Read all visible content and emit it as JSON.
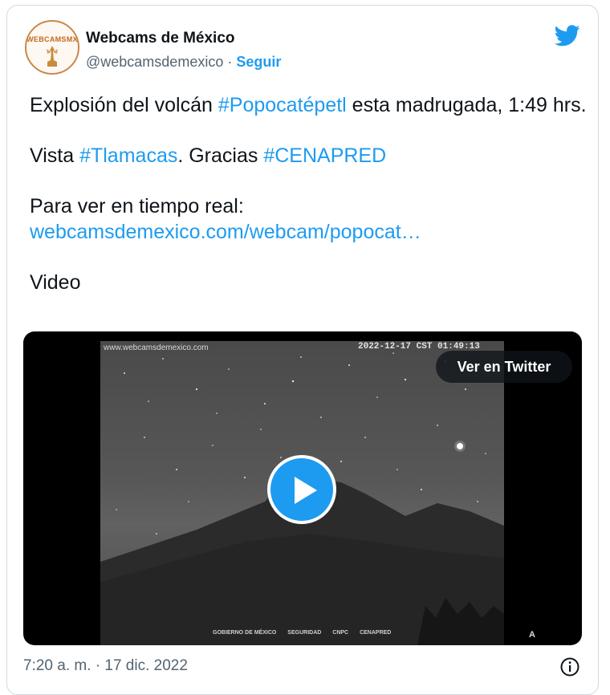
{
  "account": {
    "display_name": "Webcams de México",
    "handle": "@webcamsdemexico",
    "separator": "·",
    "follow_label": "Seguir",
    "avatar_text": "WEBCAMSMX"
  },
  "tweet": {
    "line1_pre": "Explosión del volcán ",
    "hashtag1": "#Popocatépetl",
    "line1_post": " esta madrugada, 1:49 hrs.",
    "line2_pre": "Vista ",
    "hashtag2": "#Tlamacas",
    "line2_mid": ". Gracias ",
    "hashtag3": "#CENAPRED",
    "line3": "Para ver en tiempo real:",
    "link": "webcamsdemexico.com/webcam/popocat…",
    "line4": "Video"
  },
  "media": {
    "watermark": "www.webcamsdemexico.com",
    "timestamp_overlay": "2022-12-17 CST 01:49:13",
    "view_button": "Ver en Twitter",
    "footer_logos": [
      "GOBIERNO DE MÉXICO",
      "SEGURIDAD",
      "CNPC",
      "CENAPRED"
    ],
    "corner_mark": "A"
  },
  "footer": {
    "timestamp": "7:20 a. m. · 17 dic. 2022"
  },
  "colors": {
    "accent": "#1d9bf0",
    "text": "#0f1419",
    "muted": "#536471",
    "border": "#cfd9de"
  },
  "icons": {
    "brand": "twitter-bird-icon",
    "play": "play-icon",
    "info": "info-icon"
  }
}
